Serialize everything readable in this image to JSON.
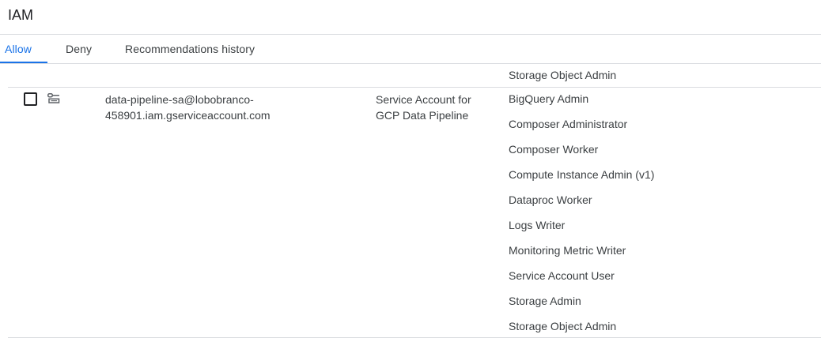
{
  "page": {
    "title": "IAM"
  },
  "tabs": [
    {
      "label": "Allow",
      "active": true
    },
    {
      "label": "Deny",
      "active": false
    },
    {
      "label": "Recommendations history",
      "active": false
    }
  ],
  "previous_row": {
    "last_role": "Storage Object Admin"
  },
  "row": {
    "principal_line1": "data-pipeline-sa@lobobranco-",
    "principal_line2": "458901.iam.gserviceaccount.com",
    "name_line1": "Service Account for",
    "name_line2": "GCP Data Pipeline",
    "icon": "service-account-icon",
    "roles": [
      "BigQuery Admin",
      "Composer Administrator",
      "Composer Worker",
      "Compute Instance Admin (v1)",
      "Dataproc Worker",
      "Logs Writer",
      "Monitoring Metric Writer",
      "Service Account User",
      "Storage Admin",
      "Storage Object Admin"
    ]
  },
  "colors": {
    "accent": "#1a73e8",
    "text": "#3c4043",
    "divider": "#dadce0"
  }
}
